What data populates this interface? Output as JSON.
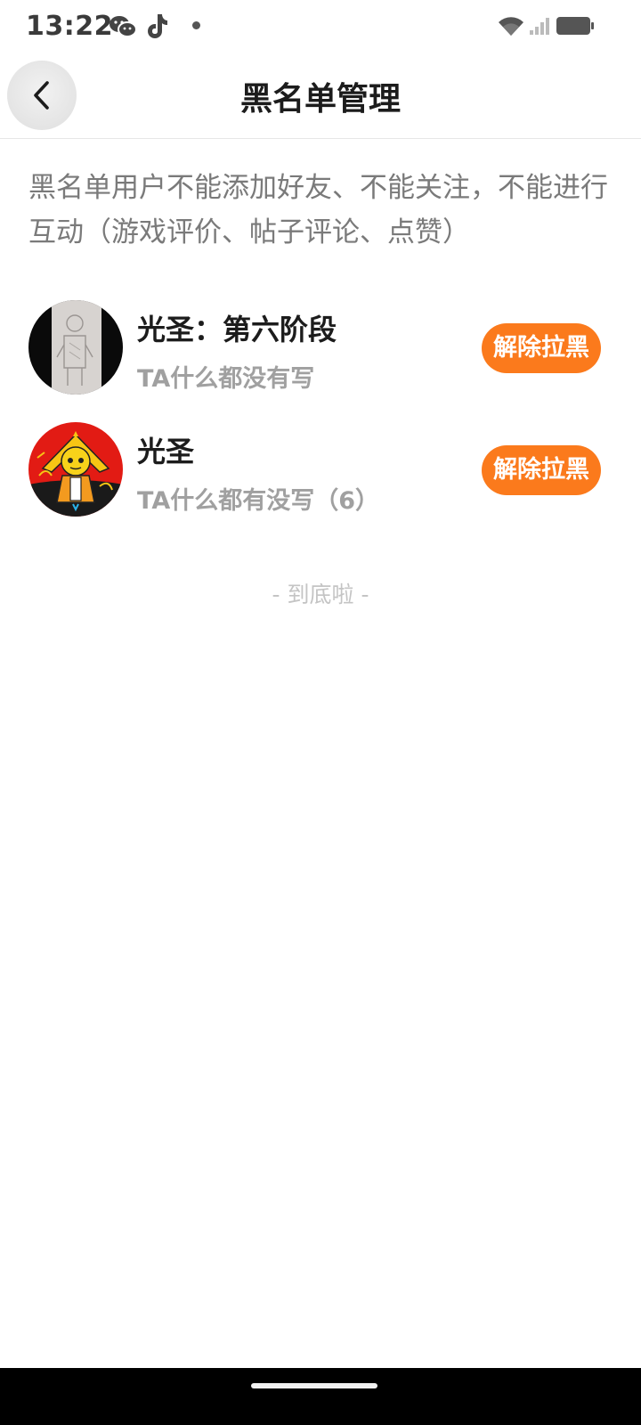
{
  "status_bar": {
    "time": "13:22",
    "icons": [
      "wechat-icon",
      "tiktok-icon",
      "dot-icon",
      "wifi-icon",
      "signal-icon",
      "battery-icon"
    ]
  },
  "header": {
    "back_icon": "chevron-left-icon",
    "title": "黑名单管理"
  },
  "notice": "黑名单用户不能添加好友、不能关注，不能进行互动（游戏评价、帖子评论、点赞）",
  "blocked_users": [
    {
      "name": "光圣：第六阶段",
      "bio": "TA什么都没有写",
      "button": "解除拉黑"
    },
    {
      "name": "光圣",
      "bio": "TA什么都有没写（6）",
      "button": "解除拉黑"
    }
  ],
  "list_end": "- 到底啦 -",
  "colors": {
    "accent": "#fb7a1c",
    "title": "#1c1c1c",
    "secondary_text": "#a0a0a0",
    "notice_text": "#7a7a7a"
  }
}
